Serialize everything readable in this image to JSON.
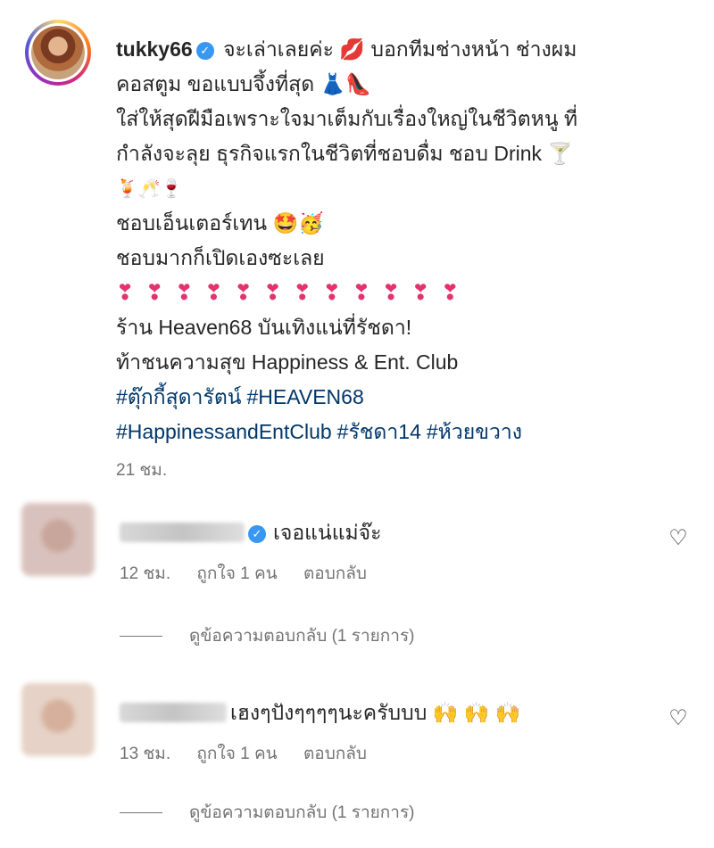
{
  "post": {
    "username": "tukky66",
    "lines": [
      "จะเล่าเลยค่ะ 💋 บอกทีมช่างหน้า ช่างผม",
      "คอสตูม ขอแบบจึ้งที่สุด 👗👠",
      "ใส่ให้สุดฝีมือเพราะใจมาเต็มกับเรื่องใหญ่ในชีวิตหนู ที่",
      "กำลังจะลุย ธุรกิจแรกในชีวิตที่ชอบดื่ม ชอบ Drink 🍸",
      "🍹🥂🍷",
      "ชอบเอ็นเตอร์เทน 🤩🥳",
      "ชอบมากก็เปิดเองซะเลย"
    ],
    "hearts": [
      "❣",
      "❣",
      "❣",
      "❣",
      "❣",
      "❣",
      "❣",
      "❣",
      "❣",
      "❣",
      "❣",
      "❣"
    ],
    "lines2": [
      "ร้าน Heaven68 บันเทิงแน่ที่รัชดา!",
      "ท้าชนความสุข Happiness & Ent. Club"
    ],
    "hashtags_line1": [
      "#ตุ๊กกี้สุดารัตน์",
      "#HEAVEN68"
    ],
    "hashtags_line2": [
      "#HappinessandEntClub",
      "#รัชดา14",
      "#ห้วยขวาง"
    ],
    "timestamp": "21 ชม.",
    "verified_icon": "verified-badge-icon"
  },
  "comments": [
    {
      "text": "เจอแน่แม่จ๊ะ",
      "verified": true,
      "time": "12 ชม.",
      "likes": "ถูกใจ 1 คน",
      "reply": "ตอบกลับ",
      "view_replies": "ดูข้อความตอบกลับ (1 รายการ)"
    },
    {
      "text": "เฮงๆปังๆๆๆๆนะครับบบ 🙌 🙌 🙌",
      "verified": false,
      "time": "13 ชม.",
      "likes": "ถูกใจ 1 คน",
      "reply": "ตอบกลับ",
      "view_replies": "ดูข้อความตอบกลับ (1 รายการ)"
    }
  ],
  "icons": {
    "like": "heart-outline-icon",
    "verified": "verified-badge-icon"
  },
  "colors": {
    "hashtag": "#00376b",
    "verified": "#3897f0",
    "meta": "#737373",
    "heart_emoji": "#e3336d"
  }
}
